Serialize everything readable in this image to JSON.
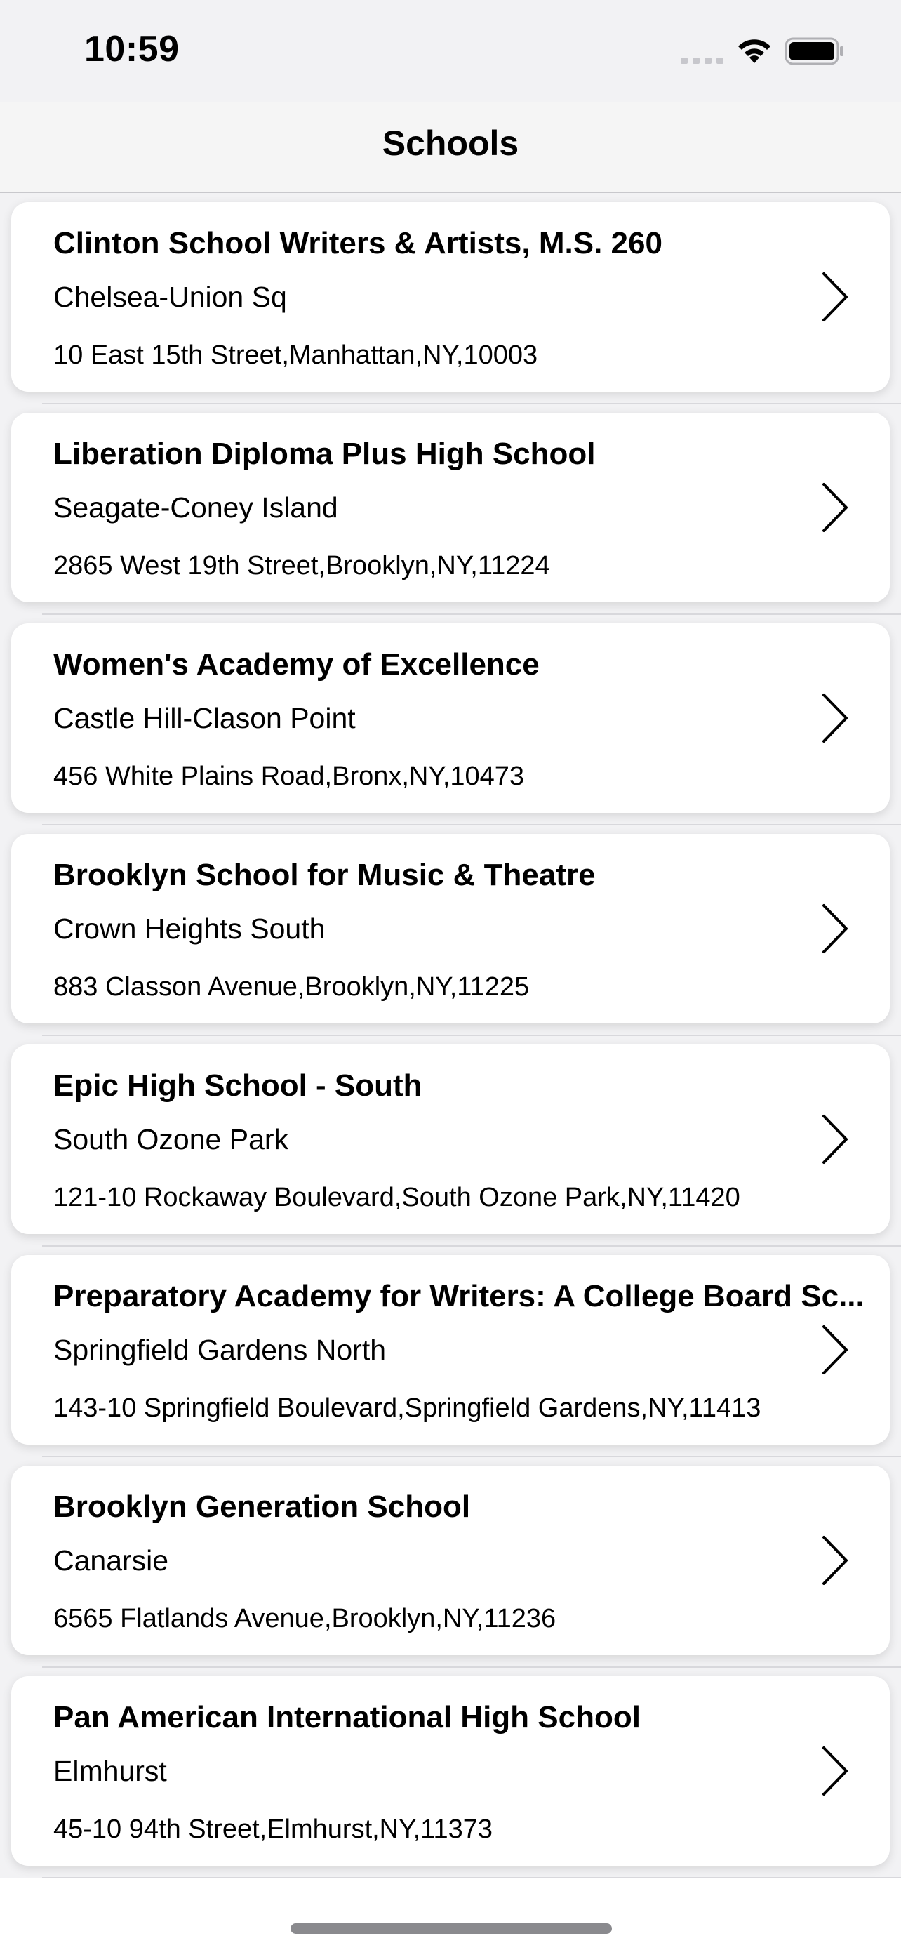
{
  "status_bar": {
    "time": "10:59",
    "icons": [
      "signal-icon",
      "wifi-icon",
      "battery-icon"
    ]
  },
  "nav": {
    "title": "Schools"
  },
  "schools": [
    {
      "name": "Clinton School Writers & Artists, M.S. 260",
      "neighborhood": "Chelsea-Union Sq",
      "address": "10 East 15th Street,Manhattan,NY,10003"
    },
    {
      "name": "Liberation Diploma Plus High School",
      "neighborhood": "Seagate-Coney Island",
      "address": "2865 West 19th Street,Brooklyn,NY,11224"
    },
    {
      "name": "Women's Academy of Excellence",
      "neighborhood": "Castle Hill-Clason Point",
      "address": "456 White Plains Road,Bronx,NY,10473"
    },
    {
      "name": "Brooklyn School for Music & Theatre",
      "neighborhood": "Crown Heights South",
      "address": "883 Classon Avenue,Brooklyn,NY,11225"
    },
    {
      "name": "Epic High School - South",
      "neighborhood": "South Ozone Park",
      "address": "121-10 Rockaway Boulevard,South Ozone Park,NY,11420"
    },
    {
      "name": "Preparatory Academy for Writers: A College Board Sc...",
      "neighborhood": "Springfield Gardens North",
      "address": "143-10 Springfield Boulevard,Springfield Gardens,NY,11413"
    },
    {
      "name": "Brooklyn Generation School",
      "neighborhood": "Canarsie",
      "address": "6565 Flatlands Avenue,Brooklyn,NY,11236"
    },
    {
      "name": "Pan American International High School",
      "neighborhood": "Elmhurst",
      "address": "45-10 94th Street,Elmhurst,NY,11373"
    }
  ],
  "colors": {
    "background": "#f2f2f4",
    "card": "#ffffff",
    "text": "#000000",
    "separator": "#d8d8dc"
  }
}
